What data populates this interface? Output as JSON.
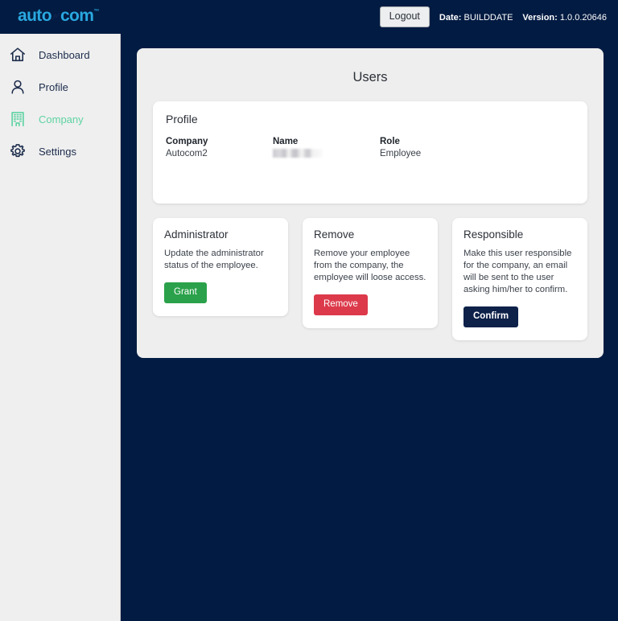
{
  "header": {
    "logo_prefix": "auto",
    "logo_bolt": "bolt-icon",
    "logo_suffix": "com",
    "logo_tm": "™",
    "logout_label": "Logout",
    "date_label": "Date:",
    "date_value": "BUILDDATE",
    "version_label": "Version:",
    "version_value": "1.0.0.20646",
    "logo_color": "#29a8e0",
    "bar_color": "#021b42"
  },
  "sidebar": {
    "items": [
      {
        "label": "Dashboard",
        "icon": "home-icon",
        "active": false
      },
      {
        "label": "Profile",
        "icon": "user-icon",
        "active": false
      },
      {
        "label": "Company",
        "icon": "building-icon",
        "active": true
      },
      {
        "label": "Settings",
        "icon": "gear-icon",
        "active": false
      }
    ],
    "active_color": "#5ed3a3",
    "text_color": "#1c2c4c"
  },
  "main": {
    "page_title": "Users",
    "profile": {
      "heading": "Profile",
      "fields": [
        {
          "label": "Company",
          "value": "Autocom2",
          "redacted": false
        },
        {
          "label": "Name",
          "value": "",
          "redacted": true
        },
        {
          "label": "Role",
          "value": "Employee",
          "redacted": false
        }
      ]
    },
    "actions": [
      {
        "title": "Administrator",
        "description": "Update the administrator status of the employee.",
        "button_label": "Grant",
        "button_color": "#2aa14a"
      },
      {
        "title": "Remove",
        "description": "Remove your employee from the company, the employee will loose access.",
        "button_label": "Remove",
        "button_color": "#dc3a4b"
      },
      {
        "title": "Responsible",
        "description": "Make this user responsible for the company, an email will be sent to the user asking him/her to confirm.",
        "button_label": "Confirm",
        "button_color": "#0d2149"
      }
    ]
  }
}
